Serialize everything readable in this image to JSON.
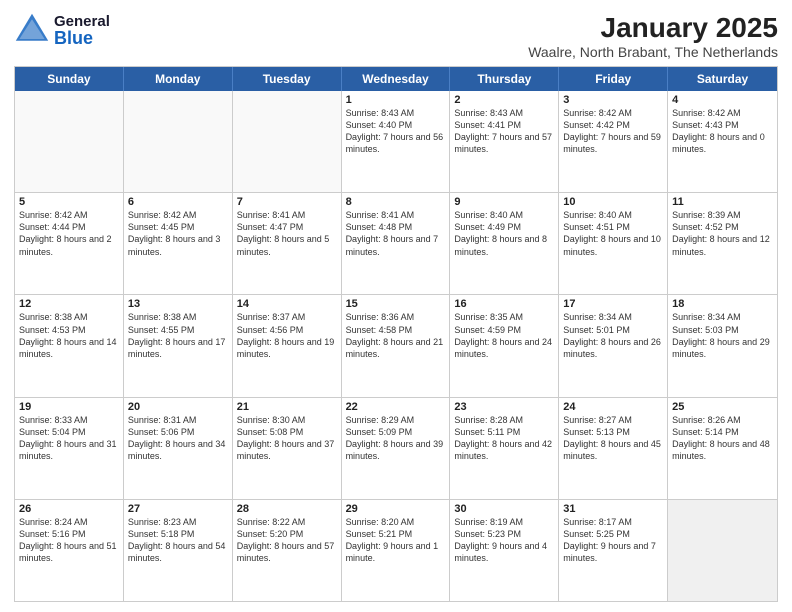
{
  "header": {
    "logo_general": "General",
    "logo_blue": "Blue",
    "month": "January 2025",
    "location": "Waalre, North Brabant, The Netherlands"
  },
  "weekdays": [
    "Sunday",
    "Monday",
    "Tuesday",
    "Wednesday",
    "Thursday",
    "Friday",
    "Saturday"
  ],
  "rows": [
    [
      {
        "day": "",
        "text": ""
      },
      {
        "day": "",
        "text": ""
      },
      {
        "day": "",
        "text": ""
      },
      {
        "day": "1",
        "text": "Sunrise: 8:43 AM\nSunset: 4:40 PM\nDaylight: 7 hours\nand 56 minutes."
      },
      {
        "day": "2",
        "text": "Sunrise: 8:43 AM\nSunset: 4:41 PM\nDaylight: 7 hours\nand 57 minutes."
      },
      {
        "day": "3",
        "text": "Sunrise: 8:42 AM\nSunset: 4:42 PM\nDaylight: 7 hours\nand 59 minutes."
      },
      {
        "day": "4",
        "text": "Sunrise: 8:42 AM\nSunset: 4:43 PM\nDaylight: 8 hours\nand 0 minutes."
      }
    ],
    [
      {
        "day": "5",
        "text": "Sunrise: 8:42 AM\nSunset: 4:44 PM\nDaylight: 8 hours\nand 2 minutes."
      },
      {
        "day": "6",
        "text": "Sunrise: 8:42 AM\nSunset: 4:45 PM\nDaylight: 8 hours\nand 3 minutes."
      },
      {
        "day": "7",
        "text": "Sunrise: 8:41 AM\nSunset: 4:47 PM\nDaylight: 8 hours\nand 5 minutes."
      },
      {
        "day": "8",
        "text": "Sunrise: 8:41 AM\nSunset: 4:48 PM\nDaylight: 8 hours\nand 7 minutes."
      },
      {
        "day": "9",
        "text": "Sunrise: 8:40 AM\nSunset: 4:49 PM\nDaylight: 8 hours\nand 8 minutes."
      },
      {
        "day": "10",
        "text": "Sunrise: 8:40 AM\nSunset: 4:51 PM\nDaylight: 8 hours\nand 10 minutes."
      },
      {
        "day": "11",
        "text": "Sunrise: 8:39 AM\nSunset: 4:52 PM\nDaylight: 8 hours\nand 12 minutes."
      }
    ],
    [
      {
        "day": "12",
        "text": "Sunrise: 8:38 AM\nSunset: 4:53 PM\nDaylight: 8 hours\nand 14 minutes."
      },
      {
        "day": "13",
        "text": "Sunrise: 8:38 AM\nSunset: 4:55 PM\nDaylight: 8 hours\nand 17 minutes."
      },
      {
        "day": "14",
        "text": "Sunrise: 8:37 AM\nSunset: 4:56 PM\nDaylight: 8 hours\nand 19 minutes."
      },
      {
        "day": "15",
        "text": "Sunrise: 8:36 AM\nSunset: 4:58 PM\nDaylight: 8 hours\nand 21 minutes."
      },
      {
        "day": "16",
        "text": "Sunrise: 8:35 AM\nSunset: 4:59 PM\nDaylight: 8 hours\nand 24 minutes."
      },
      {
        "day": "17",
        "text": "Sunrise: 8:34 AM\nSunset: 5:01 PM\nDaylight: 8 hours\nand 26 minutes."
      },
      {
        "day": "18",
        "text": "Sunrise: 8:34 AM\nSunset: 5:03 PM\nDaylight: 8 hours\nand 29 minutes."
      }
    ],
    [
      {
        "day": "19",
        "text": "Sunrise: 8:33 AM\nSunset: 5:04 PM\nDaylight: 8 hours\nand 31 minutes."
      },
      {
        "day": "20",
        "text": "Sunrise: 8:31 AM\nSunset: 5:06 PM\nDaylight: 8 hours\nand 34 minutes."
      },
      {
        "day": "21",
        "text": "Sunrise: 8:30 AM\nSunset: 5:08 PM\nDaylight: 8 hours\nand 37 minutes."
      },
      {
        "day": "22",
        "text": "Sunrise: 8:29 AM\nSunset: 5:09 PM\nDaylight: 8 hours\nand 39 minutes."
      },
      {
        "day": "23",
        "text": "Sunrise: 8:28 AM\nSunset: 5:11 PM\nDaylight: 8 hours\nand 42 minutes."
      },
      {
        "day": "24",
        "text": "Sunrise: 8:27 AM\nSunset: 5:13 PM\nDaylight: 8 hours\nand 45 minutes."
      },
      {
        "day": "25",
        "text": "Sunrise: 8:26 AM\nSunset: 5:14 PM\nDaylight: 8 hours\nand 48 minutes."
      }
    ],
    [
      {
        "day": "26",
        "text": "Sunrise: 8:24 AM\nSunset: 5:16 PM\nDaylight: 8 hours\nand 51 minutes."
      },
      {
        "day": "27",
        "text": "Sunrise: 8:23 AM\nSunset: 5:18 PM\nDaylight: 8 hours\nand 54 minutes."
      },
      {
        "day": "28",
        "text": "Sunrise: 8:22 AM\nSunset: 5:20 PM\nDaylight: 8 hours\nand 57 minutes."
      },
      {
        "day": "29",
        "text": "Sunrise: 8:20 AM\nSunset: 5:21 PM\nDaylight: 9 hours\nand 1 minute."
      },
      {
        "day": "30",
        "text": "Sunrise: 8:19 AM\nSunset: 5:23 PM\nDaylight: 9 hours\nand 4 minutes."
      },
      {
        "day": "31",
        "text": "Sunrise: 8:17 AM\nSunset: 5:25 PM\nDaylight: 9 hours\nand 7 minutes."
      },
      {
        "day": "",
        "text": ""
      }
    ]
  ]
}
